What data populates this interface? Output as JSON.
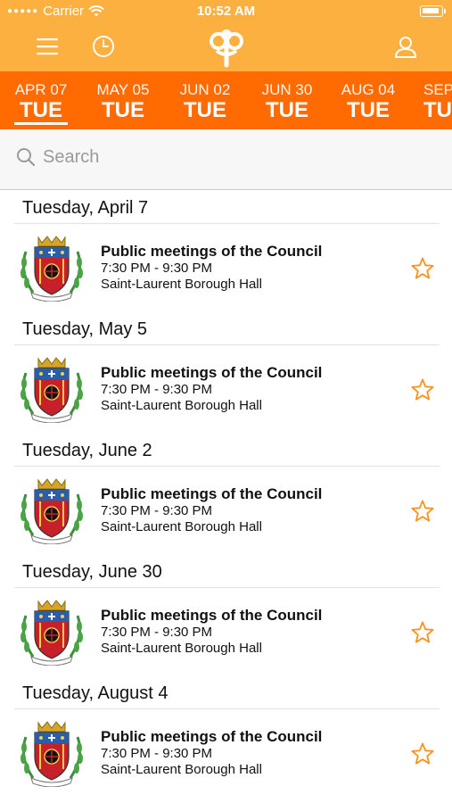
{
  "status_bar": {
    "carrier": "Carrier",
    "time": "10:52 AM"
  },
  "nav": {
    "icons": [
      "menu-icon",
      "clock-icon",
      "app-logo-icon",
      "profile-icon"
    ],
    "brand_color": "#fbb040"
  },
  "date_strip": {
    "accent_color": "#ff6b00",
    "dates": [
      {
        "month_day": "APR 07",
        "weekday": "TUE",
        "selected": true
      },
      {
        "month_day": "MAY 05",
        "weekday": "TUE"
      },
      {
        "month_day": "JUN 02",
        "weekday": "TUE"
      },
      {
        "month_day": "JUN 30",
        "weekday": "TUE"
      },
      {
        "month_day": "AUG 04",
        "weekday": "TUE"
      },
      {
        "month_day": "SEP",
        "weekday": "TU"
      }
    ]
  },
  "search": {
    "placeholder": "Search"
  },
  "sections": [
    {
      "header": "Tuesday, April 7",
      "event": {
        "title": "Public meetings of the Council",
        "time": "7:30 PM - 9:30 PM",
        "location": "Saint-Laurent Borough Hall"
      }
    },
    {
      "header": "Tuesday, May 5",
      "event": {
        "title": "Public meetings of the Council",
        "time": "7:30 PM - 9:30 PM",
        "location": "Saint-Laurent Borough Hall"
      }
    },
    {
      "header": "Tuesday, June 2",
      "event": {
        "title": "Public meetings of the Council",
        "time": "7:30 PM - 9:30 PM",
        "location": "Saint-Laurent Borough Hall"
      }
    },
    {
      "header": "Tuesday, June 30",
      "event": {
        "title": "Public meetings of the Council",
        "time": "7:30 PM - 9:30 PM",
        "location": "Saint-Laurent Borough Hall"
      }
    },
    {
      "header": "Tuesday, August 4",
      "event": {
        "title": "Public meetings of the Council",
        "time": "7:30 PM - 9:30 PM",
        "location": "Saint-Laurent Borough Hall"
      }
    }
  ],
  "favorite_icon": "star-outline-icon",
  "star_color": "#f7931e"
}
